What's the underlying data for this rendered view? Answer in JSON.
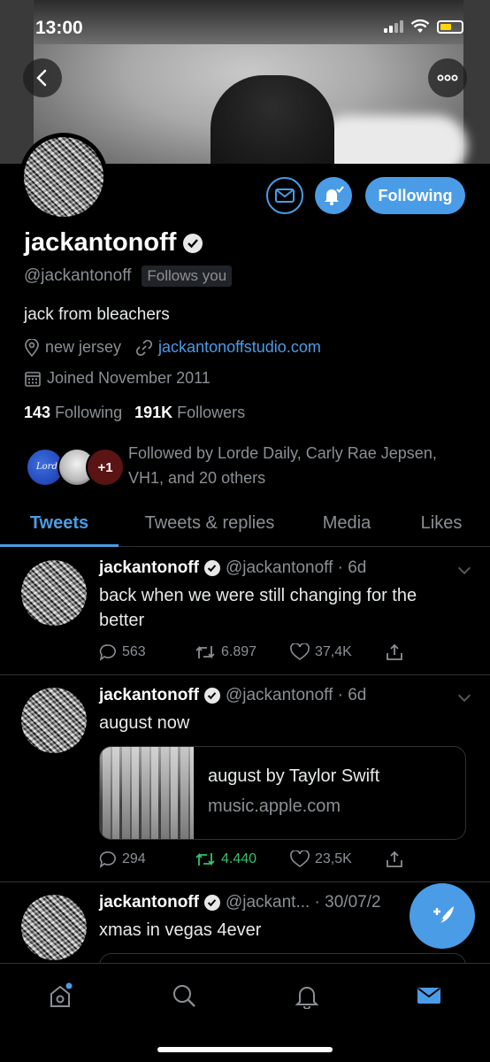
{
  "status_bar": {
    "time": "13:00"
  },
  "profile": {
    "display_name": "jackantonoff",
    "handle": "@jackantonoff",
    "follows_you": "Follows you",
    "bio": "jack from bleachers",
    "location": "new jersey",
    "website": "jackantonoffstudio.com",
    "joined": "Joined November 2011",
    "following_count": "143",
    "following_label": "Following",
    "followers_count": "191K",
    "followers_label": "Followers",
    "followed_by": "Followed by Lorde Daily, Carly Rae Jepsen, VH1, and 20 others",
    "follow_button": "Following"
  },
  "followed_by_avatars": [
    {
      "name": "lorde-daily",
      "label": "Lorde"
    },
    {
      "name": "carly-rae-jepsen",
      "label": ""
    },
    {
      "name": "vh1",
      "label": "+1"
    }
  ],
  "tabs": [
    {
      "label": "Tweets",
      "active": true
    },
    {
      "label": "Tweets & replies",
      "active": false
    },
    {
      "label": "Media",
      "active": false
    },
    {
      "label": "Likes",
      "active": false
    }
  ],
  "tweets": [
    {
      "name": "jackantonoff",
      "handle": "@jackantonoff · 6d",
      "text": "back when we were still changing for the better",
      "replies": "563",
      "retweets": "6.897",
      "likes": "37,4K"
    },
    {
      "name": "jackantonoff",
      "handle": "@jackantonoff · 6d",
      "text": "august now",
      "card_title": "august by Taylor Swift",
      "card_domain": "music.apple.com",
      "replies": "294",
      "retweets": "4.440",
      "likes": "23,5K"
    },
    {
      "name": "jackantonoff",
      "handle": "@jackant... · 30/07/2",
      "text": "xmas in vegas 4ever"
    }
  ],
  "colors": {
    "accent": "#4a9ce6",
    "retweet_active": "#32c26b",
    "muted": "#8b8f94"
  }
}
